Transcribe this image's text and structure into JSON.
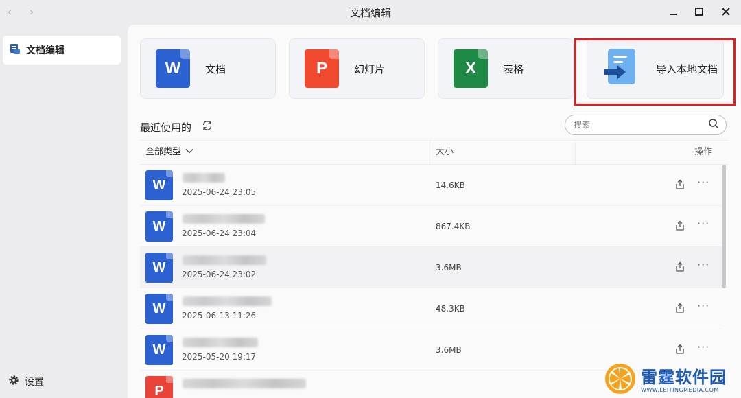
{
  "window": {
    "title": "文档编辑",
    "back_icon": "chevron-left-icon",
    "forward_icon": "chevron-right-icon",
    "nav_back_glyph": "‹",
    "nav_forward_glyph": "›"
  },
  "sidebar": {
    "items": [
      {
        "label": "文档编辑",
        "icon": "document-edit-icon",
        "selected": true
      }
    ],
    "settings_label": "设置"
  },
  "create_cards": [
    {
      "label": "文档",
      "icon_letter": "W",
      "color": "#2b61d1"
    },
    {
      "label": "幻灯片",
      "icon_letter": "P",
      "color": "#f04a2e"
    },
    {
      "label": "表格",
      "icon_letter": "X",
      "color": "#1f8a45"
    },
    {
      "label": "导入本地文档",
      "icon": "import-document-icon",
      "color": "#4a90e2"
    }
  ],
  "recent": {
    "title": "最近使用的",
    "refresh_icon": "refresh-icon"
  },
  "search": {
    "placeholder": "搜索",
    "icon": "search-icon"
  },
  "table": {
    "headers": {
      "type_filter": "全部类型",
      "size": "大小",
      "actions": "操作"
    },
    "rows": [
      {
        "type": "W",
        "date": "2025-06-24 23:05",
        "size": "14.6KB",
        "selected": false
      },
      {
        "type": "W",
        "date": "2025-06-24 23:04",
        "size": "867.4KB",
        "selected": false
      },
      {
        "type": "W",
        "date": "2025-06-24 23:02",
        "size": "3.6MB",
        "selected": true
      },
      {
        "type": "W",
        "date": "2025-06-13 11:26",
        "size": "48.3KB",
        "selected": false
      },
      {
        "type": "W",
        "date": "2025-05-20 19:17",
        "size": "3.6MB",
        "selected": false
      },
      {
        "type": "P",
        "date": "",
        "size": "",
        "selected": false
      }
    ],
    "more_glyph": "···"
  },
  "watermark": {
    "title": "雷霆软件园",
    "subtitle": "WWW.LEITINGMEDIA.COM"
  },
  "colors": {
    "accent_red_highlight": "#e02020",
    "word_blue": "#2b61d1",
    "ppt_red": "#f04a2e",
    "excel_green": "#1f8a45"
  }
}
